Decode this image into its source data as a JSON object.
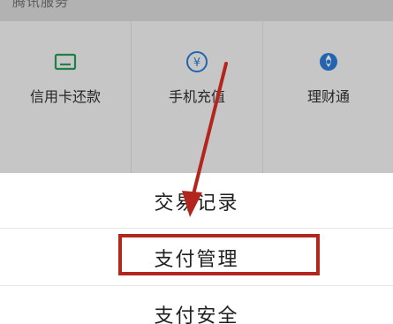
{
  "section": {
    "title": "腾讯服务"
  },
  "services": [
    {
      "label": "信用卡还款",
      "icon": "credit-card-icon"
    },
    {
      "label": "手机充值",
      "icon": "yen-coin-icon"
    },
    {
      "label": "理财通",
      "icon": "wealth-drop-icon"
    }
  ],
  "sheet": {
    "items": [
      {
        "label": "交易记录"
      },
      {
        "label": "支付管理"
      },
      {
        "label": "支付安全"
      }
    ]
  },
  "colors": {
    "icon_green": "#2a9a57",
    "icon_blue": "#2a7bd5",
    "annotation_red": "#b3261e"
  }
}
